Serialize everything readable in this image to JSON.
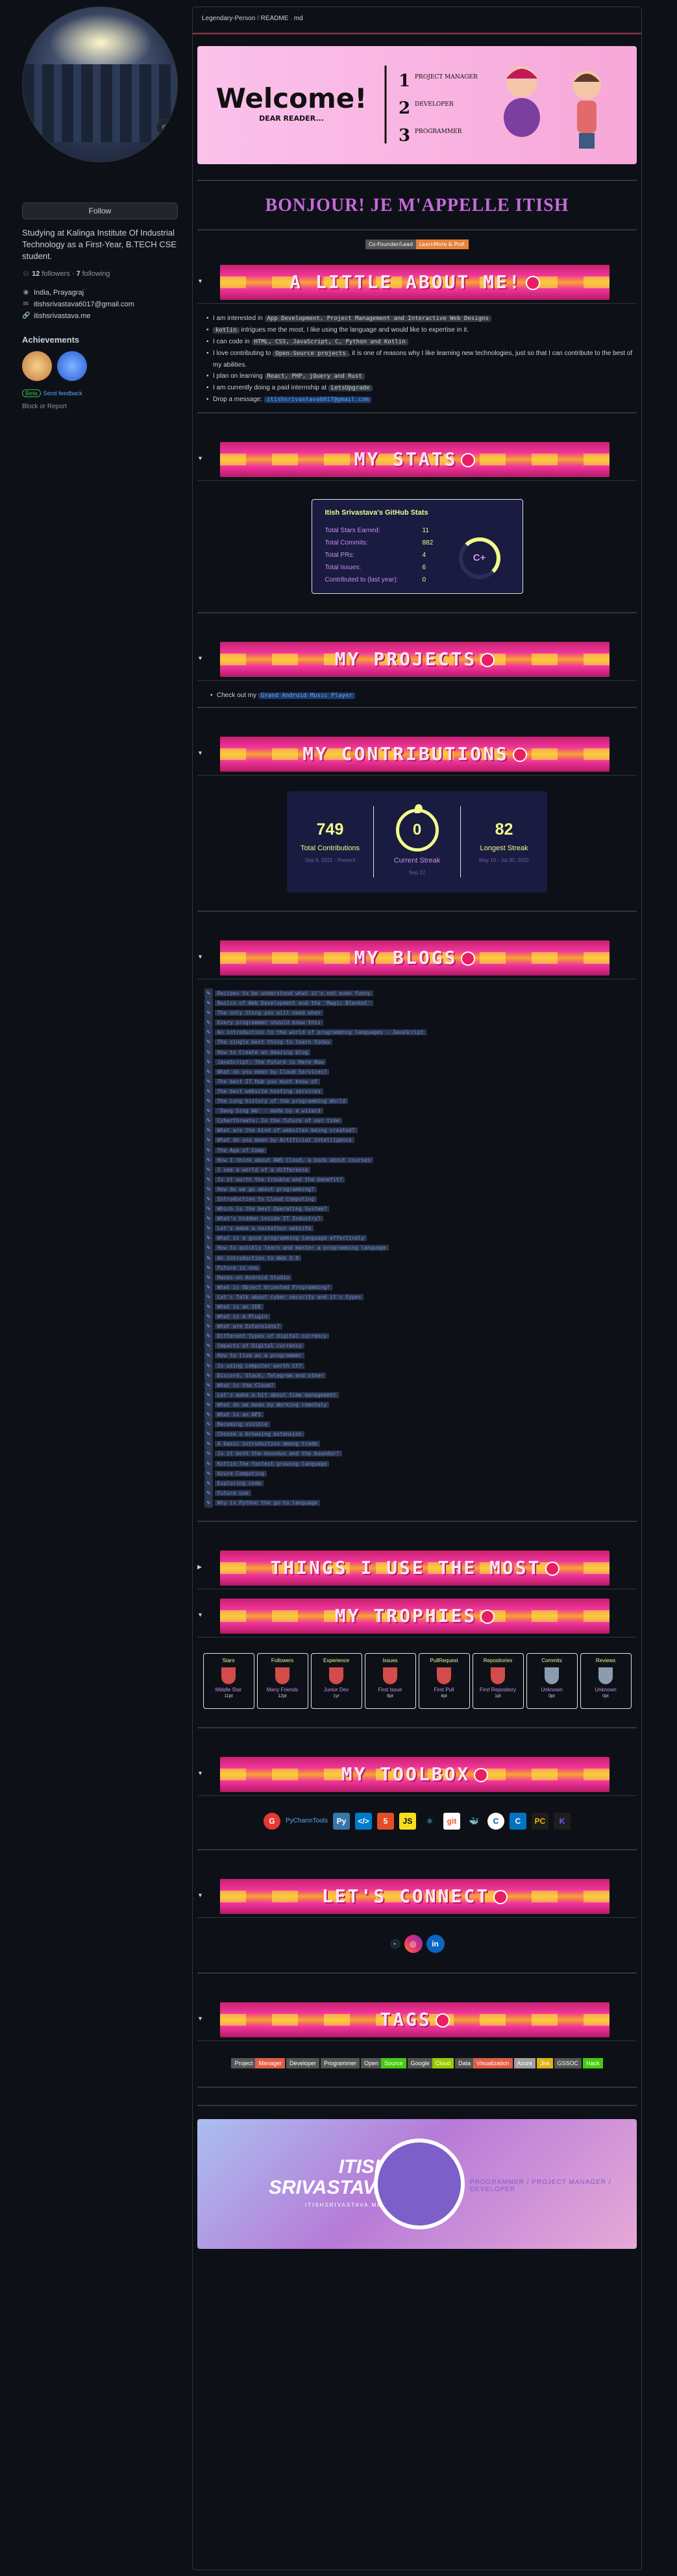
{
  "profile": {
    "follow_label": "Follow",
    "bio": "Studying at Kalinga Institute Of Industrial Technology as a First-Year, B.TECH CSE student.",
    "followers_count": "12",
    "followers_label": "followers",
    "following_count": "7",
    "following_label": "following",
    "location": "India, Prayagraj",
    "email": "itishsrivastava6017@gmail.com",
    "website": "itishsrivastava.me",
    "achievements_title": "Achievements",
    "beta_label": "Beta",
    "feedback_label": "Send feedback",
    "block_label": "Block or Report"
  },
  "breadcrumb": {
    "user": "Legendary-Person",
    "repo": "README",
    "file": "md"
  },
  "welcome": {
    "title": "Welcome!",
    "sub": "DEAR READER...",
    "r1": "PROJECT MANAGER",
    "r2": "DEVELOPER",
    "r3": "PROGRAMMER"
  },
  "greeting": "BONJOUR! JE M'APPELLE ITISH",
  "badges": {
    "b1": "Co-Founder/Lead",
    "b2": "LearnMore & Prof."
  },
  "sections": {
    "about": "A LITTLE ABOUT ME!",
    "stats": "MY STATS",
    "projects": "MY PROJECTS",
    "contributions": "MY CONTRIBUTIONS",
    "blogs": "MY BLOGS",
    "things": "THINGS I USE THE MOST",
    "trophies": "MY TROPHIES",
    "toolbox": "MY TOOLBOX",
    "connect": "LET'S CONNECT",
    "tags": "TAGS"
  },
  "about": {
    "l1a": "I am interested in",
    "l1b": "App Development, Project Management and Interactive Web Designs",
    "l2a": "kotlin",
    "l2b": "intrigues me the most, I like using the language and would like to expertise in it.",
    "l3a": "I can code in",
    "l3b": "HTML, CSS, JavaScript, C, Python and Kotlin",
    "l4a": "I love contributing to",
    "l4b": "Open-Source projects",
    "l4c": ", it is one of reasons why I like learning new technologies, just so that I can contribute to the best of my abilities.",
    "l5a": "I plan on learning",
    "l5b": "React, PHP, jQuery and Rust",
    "l6a": "I am currently doing a paid internship at",
    "l6b": "LetsUpgrade",
    "l7a": "Drop a message:",
    "l7b": "itishsrivastava6017@gmail.com"
  },
  "stats": {
    "title": "Itish Srivastava's GitHub Stats",
    "rows": [
      {
        "k": "Total Stars Earned:",
        "v": "11"
      },
      {
        "k": "Total Commits:",
        "v": "882"
      },
      {
        "k": "Total PRs:",
        "v": "4"
      },
      {
        "k": "Total Issues:",
        "v": "6"
      },
      {
        "k": "Contributed to (last year):",
        "v": "0"
      }
    ],
    "grade": "C+"
  },
  "projects": {
    "prefix": "Check out my",
    "link": "Grand Android Music Player"
  },
  "streak": {
    "total": "749",
    "total_label": "Total Contributions",
    "total_sub": "Sep 8, 2021 - Present",
    "current": "0",
    "current_label": "Current Streak",
    "current_sub": "Sep 22",
    "longest": "82",
    "longest_label": "Longest Streak",
    "longest_sub": "May 10 - Jul 30, 2022"
  },
  "blogs": [
    "Recipes to be understood what it's not even funny",
    "Basics of Web Development and the 'Magic Blanket'",
    "The only thing you will need when",
    "Every programmer should know this",
    "An introduction to the world of programming languages - JavaScript",
    "The single best thing to learn today",
    "How to Create an Amazing blog",
    "JavaScript: The Future is Here Now",
    "What do you mean by Cloud Services?",
    "The best IT Hub you must know of",
    "The best website hosting services",
    "The Long history of the programming World",
    "'Dang Sing We' - made by a wizard",
    "Cyberthreats: Is the future of our time",
    "What are the kind of websites being created?",
    "What do you mean by Artificial intelligence",
    "The Age of Comp",
    "How I think about AWS Cloud, a book about courses",
    "I see a world of a difference",
    "Is it worth the trouble and the benefit?",
    "How do we go about programming?",
    "Introduction to Cloud Computing",
    "Which is the best Operating System?",
    "What's hidden inside IT Industry?",
    "Let's make a hackathon website",
    "What is a good programming language effectively",
    "How to quickly learn and master a programming language",
    "An introduction to Web 3.0",
    "Future is now",
    "Hands-on Android Studio",
    "What is Object Oriented Programming?",
    "Let's Talk about cyber security and it's types",
    "What is an IDE",
    "What is a Plugin",
    "What are Extensions?",
    "Different types of digital currency",
    "Impacts of Digital currency",
    "How to live as a programmer",
    "Is using computer worth it?",
    "Discord, Slack, Telegram and other",
    "What is the Cloud?",
    "Let's make a bit about time management",
    "What do we mean by Working remotely",
    "What is an API",
    "Becoming visible",
    "Choose a browsing extension",
    "A basic introduction among trade",
    "Is it both the boondus and the boundor?",
    "Kotlin:The fastest growing language",
    "Azure Computing",
    "Exploring code",
    "Future use",
    "Why is Python the go-to language"
  ],
  "trophies": [
    {
      "t": "Stars",
      "r": "Middle Star",
      "v": "11pt"
    },
    {
      "t": "Followers",
      "r": "Many Friends",
      "v": "12pt"
    },
    {
      "t": "Experience",
      "r": "Junior Dev",
      "v": "1yr"
    },
    {
      "t": "Issues",
      "r": "First Issue",
      "v": "6pt"
    },
    {
      "t": "PullRequest",
      "r": "First Pull",
      "v": "4pt"
    },
    {
      "t": "Repositories",
      "r": "First Repository",
      "v": "1pt"
    },
    {
      "t": "Commits",
      "r": "Unknown",
      "v": "0pt"
    },
    {
      "t": "Reviews",
      "r": "Unknown",
      "v": "0pt"
    }
  ],
  "toolbox": {
    "broken": "PyCharmTools"
  },
  "tags": [
    "Project",
    "Manager",
    "Developer",
    "Programmer",
    "Open",
    "Source",
    "Google",
    "Cloud",
    "Data",
    "Visualization",
    "Azure",
    "Jira",
    "GSSOC",
    "Hack"
  ],
  "footer": {
    "name1": "ITISH",
    "name2": "SRIVASTAVA",
    "handle": "ITISHSRIVASTAVA.ME",
    "role": "PROGRAMMER / PROJECT MANAGER / DEVELOPER"
  }
}
